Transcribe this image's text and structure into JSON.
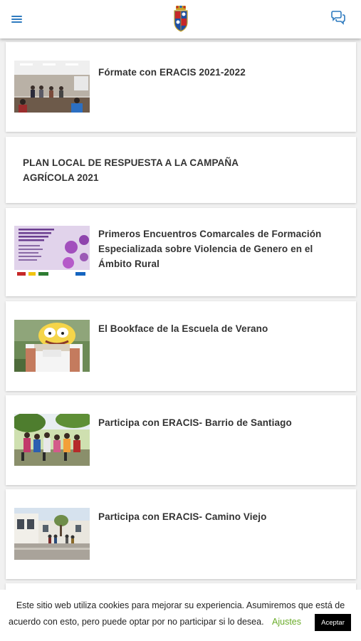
{
  "header": {
    "menu_icon": "hamburger-menu-icon",
    "logo_icon": "coat-of-arms-icon",
    "chat_icon": "chat-bubbles-icon",
    "accent_color": "#2f7bbf"
  },
  "feed": {
    "items": [
      {
        "title": "Fórmate con ERACIS 2021-2022",
        "has_image": true,
        "image": "classroom-meeting-photo"
      },
      {
        "title": "PLAN LOCAL DE RESPUESTA A LA CAMPAÑA AGRÍCOLA 2021",
        "has_image": false
      },
      {
        "title": "Primeros Encuentros Comarcales de Formación Especializada sobre Violencia de Genero en el Ámbito Rural",
        "has_image": true,
        "image": "event-poster"
      },
      {
        "title": "El Bookface de la Escuela de Verano",
        "has_image": true,
        "image": "cartoon-bookface-photo"
      },
      {
        "title": "Participa con ERACIS- Barrio de Santiago",
        "has_image": true,
        "image": "outdoor-group-photo"
      },
      {
        "title": "Participa con ERACIS- Camino Viejo",
        "has_image": true,
        "image": "street-gathering-photo"
      }
    ]
  },
  "cookie_banner": {
    "line1": "Este sitio web utiliza cookies para mejorar su experiencia. Asumiremos que está de",
    "line2": "acuerdo con esto, pero puede optar por no participar si lo desea.",
    "settings_label": "Ajustes",
    "accept_label": "Aceptar",
    "settings_color": "#6aac2a"
  }
}
